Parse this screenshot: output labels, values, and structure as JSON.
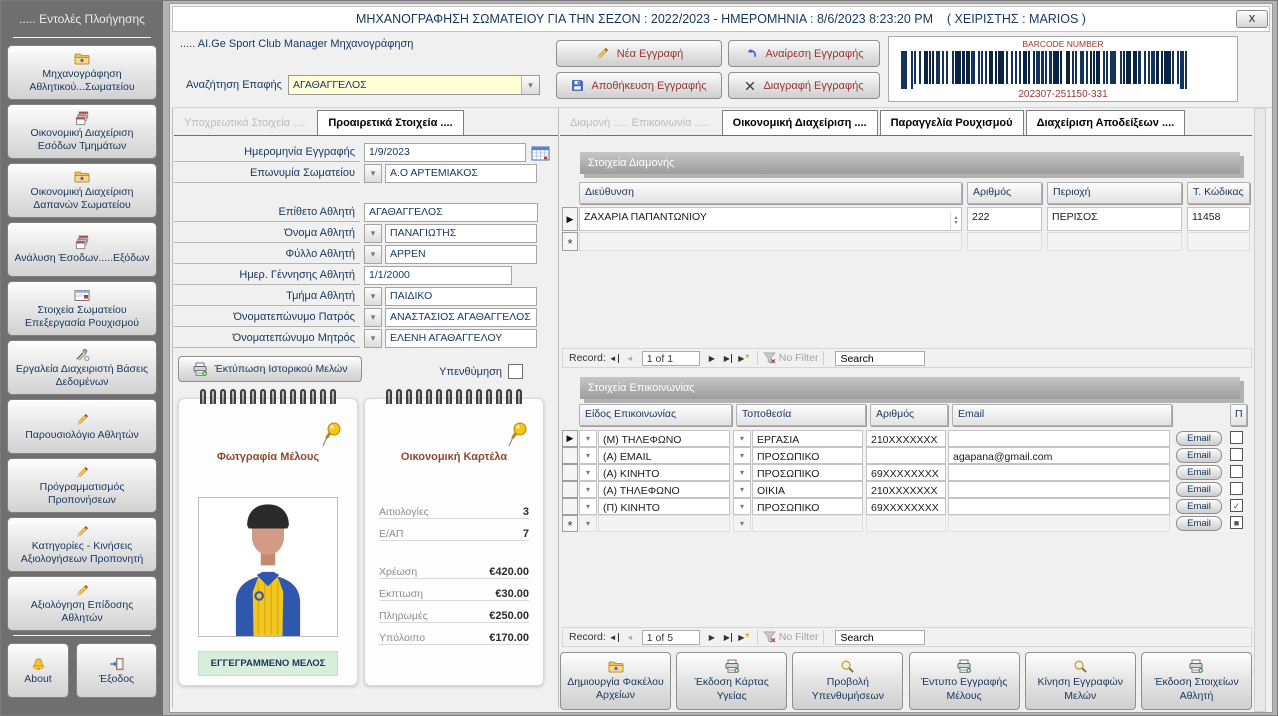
{
  "window": {
    "titlebar": "ΜΗΧΑΝΟΓΡΑΦΗΣΗ ΣΩΜΑΤΕΙΟΥ ΓΙΑ ΤΗΝ ΣΕΖΟΝ : 2022/2023 - ΗΜΕΡΟΜΗΝΙΑ : 8/6/2023 8:23:20 PM    ( ΧΕΙΡΙΣΤΗΣ : MARIOS )",
    "close_glyph": "X"
  },
  "sidebar": {
    "header": "..... Εντολές Πλοήγησης",
    "items": [
      {
        "icon": "folder-icon",
        "label": "Μηχανογράφηση Αθλητικού...Σωματείου"
      },
      {
        "icon": "forms-icon",
        "label": "Οικονομική Διαχείριση Εσόδων Τμημάτων"
      },
      {
        "icon": "folder-icon",
        "label": "Οικονομική Διαχείριση Δαπανών Σωματείου"
      },
      {
        "icon": "forms-icon",
        "label": "Ανάλυση Έσοδων.....Εξόδων"
      },
      {
        "icon": "mail-icon",
        "label": "Στοιχεία Σωματείου Επεξεργασία Ρουχισμού"
      },
      {
        "icon": "tools-icon",
        "label": "Εργαλεία Διαχειριστή Βάσεις Δεδομένων"
      },
      {
        "icon": "pencil-icon",
        "label": "Παρουσιολόγιο Αθλητών"
      },
      {
        "icon": "pencil-icon",
        "label": "Πρόγραμματισμός Προπονήσεων"
      },
      {
        "icon": "pencil-icon",
        "label": "Κατηγορίες - Κινήσεις Αξιολογήσεων Προπονητή"
      },
      {
        "icon": "pencil-icon",
        "label": "Αξιολόγηση Επίδοσης Αθλητών"
      }
    ],
    "about_label": "About",
    "exit_label": "Έξοδος"
  },
  "header": {
    "app_label": "..... AI.Ge Sport Club Manager Μηχανογράφηση",
    "search_label": "Αναζήτηση Επαφής",
    "search_value": "ΑΓΑΘΑΓΓΕΛΟΣ",
    "actions": {
      "new": "Νέα Εγγραφή",
      "undo": "Αναίρεση Εγγραφής",
      "save": "Αποθήκευση Εγγραφής",
      "delete": "Διαγραφή Εγγραφής"
    },
    "barcode": {
      "title": "BARCODE NUMBER",
      "number": "202307-251150-331"
    }
  },
  "left_tabs": {
    "tab1": "Υποχρεωτικά Στοιχεία ....",
    "tab2": "Προαιρετικά Στοιχεία ...."
  },
  "form": {
    "reg_date": {
      "label": "Ημερομηνία Εγγραφής",
      "value": "1/9/2023"
    },
    "club": {
      "label": "Επωνυμία Σωματείου",
      "value": "Α.Ο ΑΡΤΕΜΙΑΚΟΣ"
    },
    "surname": {
      "label": "Επίθετο Αθλητή",
      "value": "ΑΓΑΘΑΓΓΕΛΟΣ"
    },
    "name": {
      "label": "Όνομα Αθλητή",
      "value": "ΠΑΝΑΓΙΩΤΗΣ"
    },
    "sex": {
      "label": "Φύλλο Αθλητή",
      "value": "ΑΡΡΕΝ"
    },
    "birth": {
      "label": "Ημερ. Γέννησης Αθλητή",
      "value": "1/1/2000"
    },
    "team": {
      "label": "Τμήμα Αθλητή",
      "value": "ΠΑΙΔΙΚΟ"
    },
    "father": {
      "label": "Όνοματεπώνυμο Πατρός",
      "value": "ΑΝΑΣΤΑΣΙΟΣ ΑΓΑΘΑΓΓΕΛΟΣ"
    },
    "mother": {
      "label": "Όνοματεπώνυμο Μητρός",
      "value": "ΕΛΕΝΗ ΑΓΑΘΑΓΓΕΛΟΥ"
    },
    "print_history": "Έκτύπωση Ιστορικού Μελών",
    "reminder_label": "Υπενθύμηση"
  },
  "photo_card": {
    "title": "Φωτγραφία Μέλους",
    "badge": "ΕΓΓΕΓΡΑΜΜΕΝΟ ΜΕΛΟΣ"
  },
  "finance_card": {
    "title": "Οικονομική Καρτέλα",
    "rows": [
      {
        "label": "Αιτιολογίες",
        "value": "3"
      },
      {
        "label": "Ε/ΑΠ",
        "value": "7"
      },
      {
        "label": "Χρέωση",
        "value": "€420.00"
      },
      {
        "label": "Εκπτωση",
        "value": "€30.00"
      },
      {
        "label": "Πληρωμές",
        "value": "€250.00"
      },
      {
        "label": "Υπόλοιπο",
        "value": "€170.00"
      }
    ]
  },
  "right_tabs": {
    "tab1": "Διαμονή ..... Επικοινωνία .....",
    "tab2": "Οικονομική Διαχείριση ....",
    "tab3": "Παραγγελία Ρουχισμού",
    "tab4": "Διαχείριση Αποδείξεων ...."
  },
  "stay": {
    "title": "Στοιχεία Διαμονής",
    "headers": [
      "Διεύθυνση",
      "Αριθμός",
      "Περιοχή",
      "Τ. Κώδικας"
    ],
    "row": {
      "address": "ΖΑΧΑΡΙΑ ΠΑΠΑΝΤΩΝΙΟΥ",
      "number": "222",
      "area": "ΠΕΡΙΣΟΣ",
      "zip": "11458"
    },
    "nav": {
      "record_label": "Record:",
      "position": "1 of 1",
      "no_filter": "No Filter",
      "search": "Search"
    }
  },
  "comm": {
    "title": "Στοιχεία Επικοινωνίας",
    "headers": [
      "Είδος Επικοινωνίας",
      "Τοποθεσία",
      "Αριθμός",
      "Email",
      "Π"
    ],
    "email_button": "Email",
    "rows": [
      {
        "type": "(Μ) ΤΗΛΕΦΩΝΟ",
        "location": "ΕΡΓΑΣΙΑ",
        "number": "210XXXXXXX",
        "email": "",
        "check": ""
      },
      {
        "type": "(Α) EMAIL",
        "location": "ΠΡΟΣΩΠΙΚΟ",
        "number": "",
        "email": "agapana@gmail.com",
        "check": ""
      },
      {
        "type": "(Α) ΚΙΝΗΤΟ",
        "location": "ΠΡΟΣΩΠΙΚΟ",
        "number": "69XXXXXXXX",
        "email": "",
        "check": ""
      },
      {
        "type": "(Α) ΤΗΛΕΦΩΝΟ",
        "location": "ΟΙΚΙΑ",
        "number": "210XXXXXXX",
        "email": "",
        "check": ""
      },
      {
        "type": "(Π) ΚΙΝΗΤΟ",
        "location": "ΠΡΟΣΩΠΙΚΟ",
        "number": "69XXXXXXXX",
        "email": "",
        "check": "✓"
      },
      {
        "type": "",
        "location": "",
        "number": "",
        "email": "",
        "check": "■"
      }
    ],
    "nav": {
      "record_label": "Record:",
      "position": "1 of 5",
      "no_filter": "No Filter",
      "search": "Search"
    }
  },
  "footer_buttons": [
    {
      "icon": "folder-icon",
      "label": "Δημιουργία Φακέλου Αρχείων"
    },
    {
      "icon": "printer-icon",
      "label": "Έκδοση Κάρτας Υγείας"
    },
    {
      "icon": "search-icon",
      "label": "Προβολή Υπενθυμήσεων"
    },
    {
      "icon": "printer-icon",
      "label": "Έντυπο Εγγραφής Μέλους"
    },
    {
      "icon": "search-icon",
      "label": "Κίνηση Εγγραφών Μελών"
    },
    {
      "icon": "printer-icon",
      "label": "Έκδοση Στοιχείων Αθλητή"
    }
  ],
  "colors": {
    "accent_navy": "#17365D",
    "accent_maroon": "#943634",
    "barcode_bar": "#14335c",
    "badge_green": "#d8eedb",
    "search_yellow": "#FFFFD6",
    "sidebar_gray": "#6f6f6f"
  }
}
